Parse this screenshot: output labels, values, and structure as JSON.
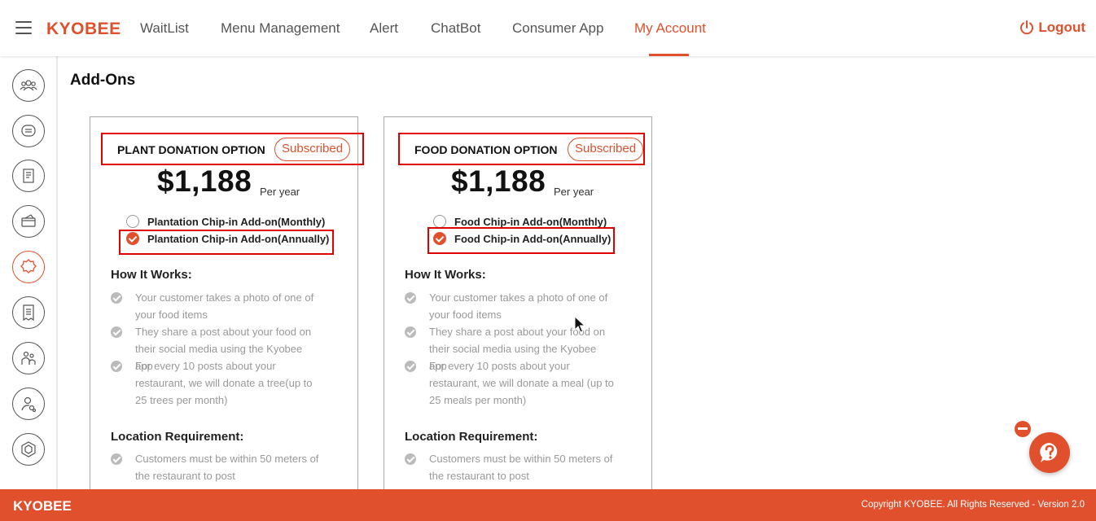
{
  "app": {
    "brand": "KYOBEE"
  },
  "nav": {
    "items": [
      {
        "label": "WaitList"
      },
      {
        "label": "Menu Management"
      },
      {
        "label": "Alert"
      },
      {
        "label": "ChatBot"
      },
      {
        "label": "Consumer App"
      },
      {
        "label": "My Account",
        "active": true
      }
    ],
    "logout": "Logout"
  },
  "sidebar": {
    "items": [
      {
        "icon": "users-icon"
      },
      {
        "icon": "chat-icon"
      },
      {
        "icon": "menu-icon"
      },
      {
        "icon": "card-icon"
      },
      {
        "icon": "badge-icon",
        "active": true
      },
      {
        "icon": "receipt-icon"
      },
      {
        "icon": "family-icon"
      },
      {
        "icon": "user-link-icon"
      },
      {
        "icon": "hexagon-icon"
      }
    ]
  },
  "page": {
    "title": "Add-Ons"
  },
  "cards": [
    {
      "title": "PLANT DONATION OPTION",
      "status": "Subscribed",
      "price": "$1,188",
      "period": "Per year",
      "options": [
        {
          "label": "Plantation Chip-in Add-on(Monthly)",
          "selected": false
        },
        {
          "label": "Plantation Chip-in Add-on(Annually)",
          "selected": true
        }
      ],
      "how_title": "How It Works:",
      "how": [
        "Your customer takes a photo of one of your food items",
        "They share a post about your food on their social media using the Kyobee app",
        "For every 10 posts about your restaurant, we will donate a tree(up to 25 trees per month)"
      ],
      "loc_title": "Location Requirement:",
      "loc": [
        "Customers must be within 50 meters of the restaurant to post"
      ]
    },
    {
      "title": "FOOD DONATION OPTION",
      "status": "Subscribed",
      "price": "$1,188",
      "period": "Per year",
      "options": [
        {
          "label": "Food Chip-in Add-on(Monthly)",
          "selected": false
        },
        {
          "label": "Food Chip-in Add-on(Annually)",
          "selected": true
        }
      ],
      "how_title": "How It Works:",
      "how": [
        "Your customer takes a photo of one of your food items",
        "They share a post about your food on their social media using the Kyobee app",
        "For every 10 posts about your restaurant, we will donate a meal (up to 25 meals per month)"
      ],
      "loc_title": "Location Requirement:",
      "loc": [
        "Customers must be within 50 meters of the restaurant to post"
      ]
    }
  ],
  "footer": {
    "brand": "KYOBEE",
    "copyright": "Copyright KYOBEE. All Rights Reserved - Version 2.0"
  },
  "colors": {
    "accent": "#e0502d",
    "highlight": "#e00000"
  }
}
